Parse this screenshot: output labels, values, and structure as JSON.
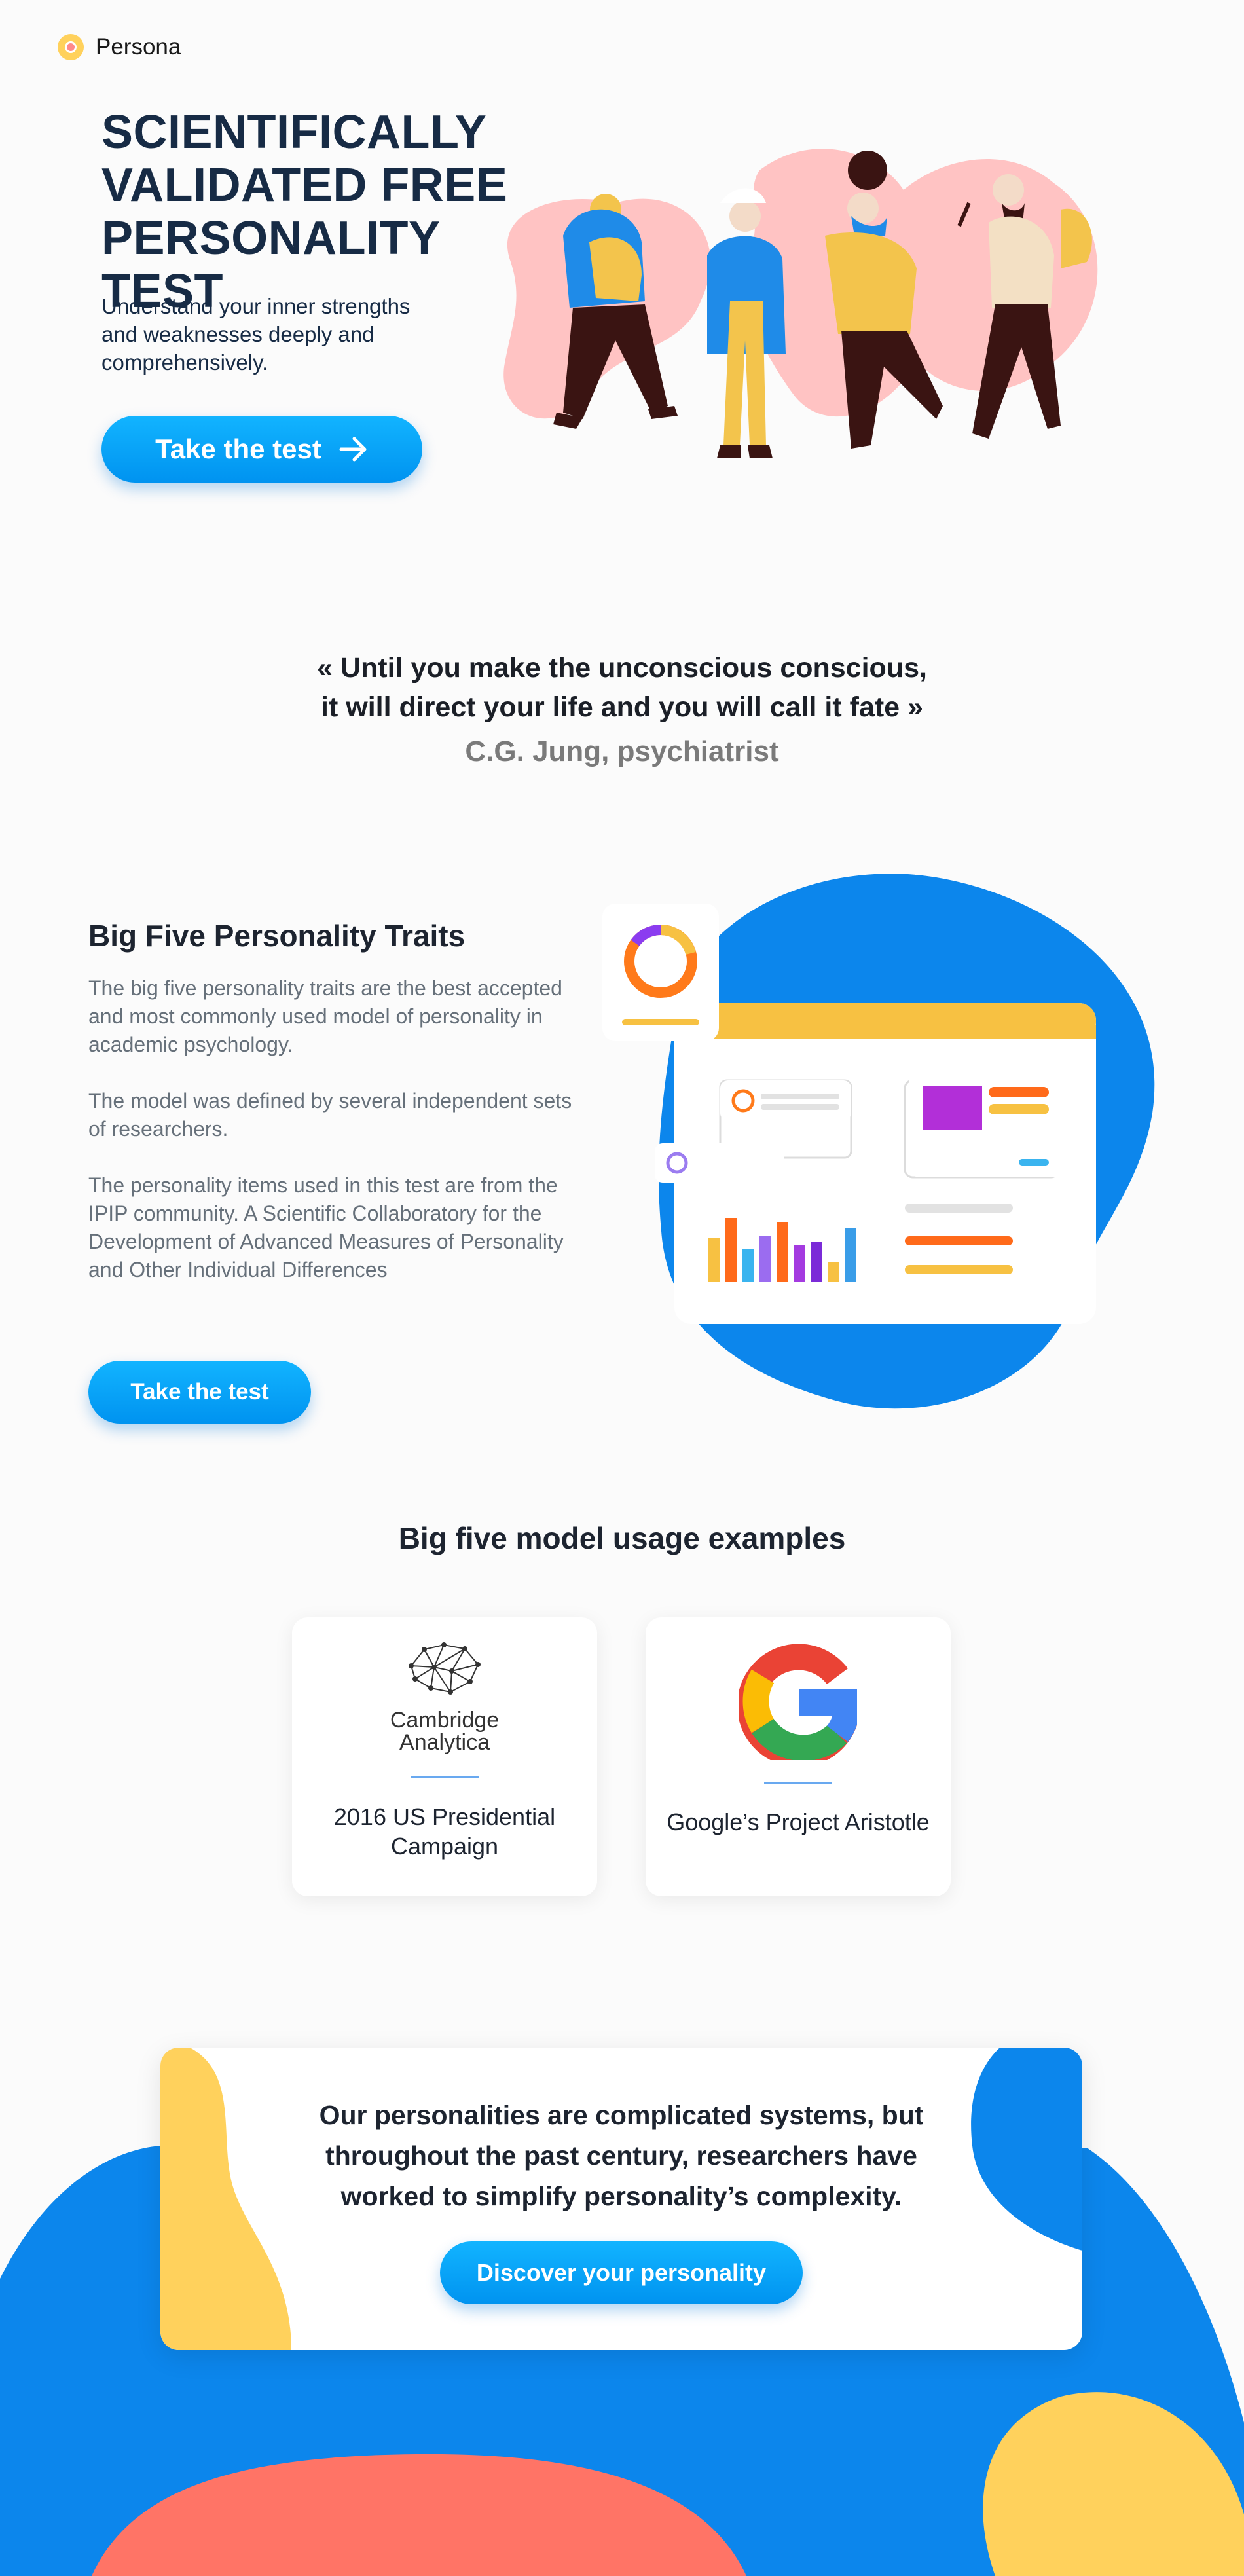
{
  "header": {
    "logo_text": "Persona"
  },
  "hero": {
    "title": "SCIENTIFICALLY VALIDATED FREE PERSONALITY TEST",
    "subtitle": "Understand your inner strengths and weaknesses deeply and comprehensively.",
    "cta_label": "Take the test"
  },
  "quote": {
    "line1": "« Until you make the unconscious conscious,",
    "line2": "it will direct your life and you will call it fate »",
    "author": "C.G. Jung, psychiatrist"
  },
  "big_five": {
    "title": "Big Five Personality Traits",
    "paragraphs": [
      "The big five personality traits are the best accepted and most commonly used model of personality in academic psychology.",
      "The model was defined by several independent sets of researchers.",
      "The personality items used in this test are from the IPIP community. A Scientific Collaboratory for the Development of Advanced Measures of Personality and Other Individual Differences"
    ],
    "cta_label": "Take the test"
  },
  "usage": {
    "title": "Big five model usage examples",
    "cards": [
      {
        "logo_text": "Cambridge Analytica",
        "label": "2016 US Presidential Campaign"
      },
      {
        "logo_text": "",
        "label": "Google’s Project Aristotle"
      }
    ]
  },
  "cta": {
    "text": "Our personalities are complicated systems, but throughout the past century, researchers have worked to simplify personality’s complexity.",
    "button_label": "Discover your personality"
  },
  "colors": {
    "primary": "#0093f0",
    "navy": "#172b45",
    "yellow": "#ffd15c",
    "coral": "#ff7466",
    "blob_blue": "#0c86ec",
    "pink": "#ffc3c3"
  }
}
